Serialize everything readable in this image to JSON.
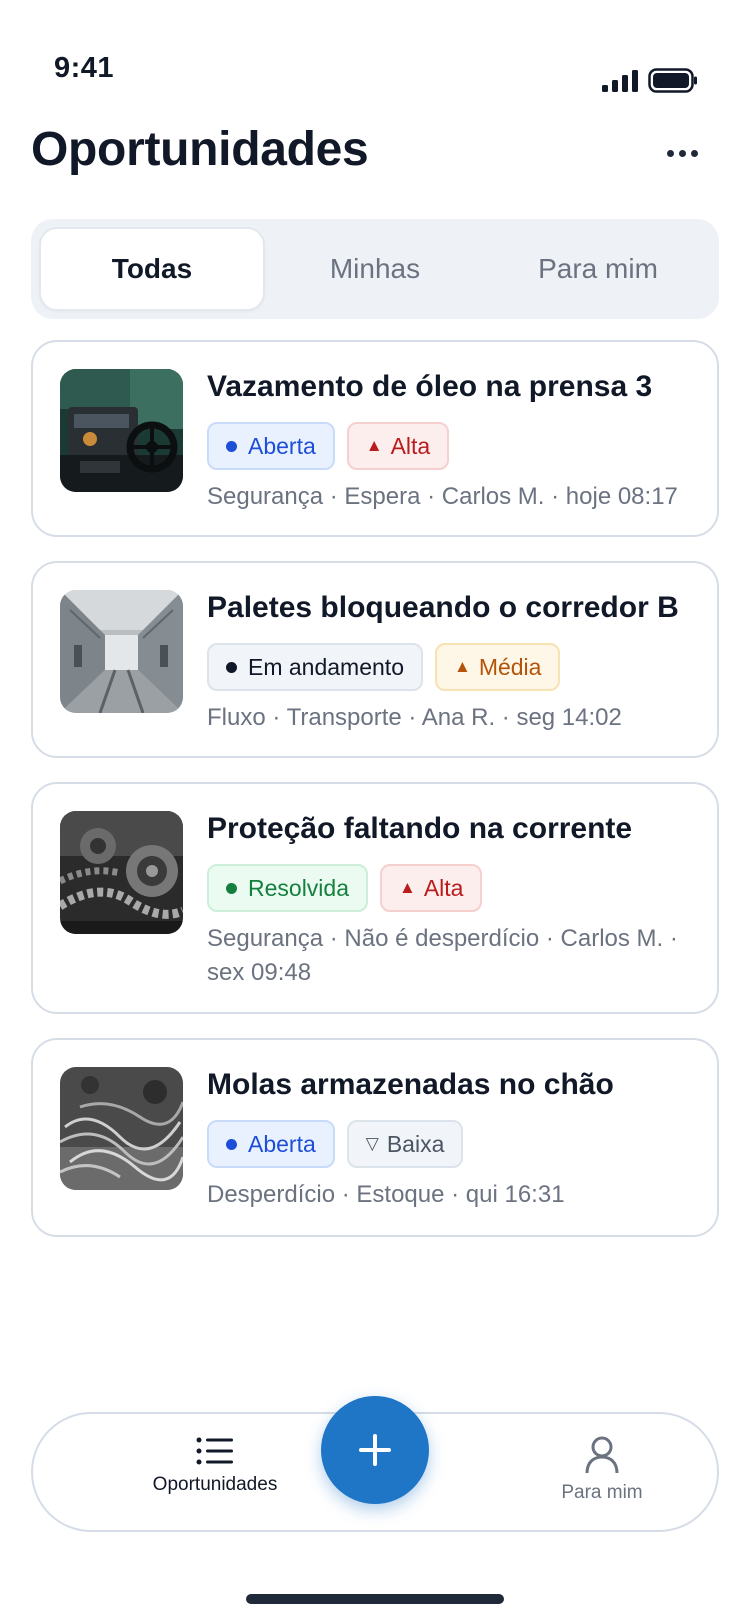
{
  "status_bar": {
    "time": "9:41"
  },
  "header": {
    "title": "Oportunidades",
    "more_icon": "more-horizontal-icon"
  },
  "tabs": [
    {
      "label": "Todas",
      "active": true
    },
    {
      "label": "Minhas",
      "active": false
    },
    {
      "label": "Para mim",
      "active": false
    }
  ],
  "opportunities": [
    {
      "title": "Vazamento de óleo na prensa 3",
      "status": "Aberta",
      "priority": "Alta",
      "meta": "Segurança · Espera · Carlos M. · hoje 08:17",
      "image": "industrial-press-photo"
    },
    {
      "title": "Paletes bloqueando o corredor B",
      "status": "Em andamento",
      "priority": "Média",
      "meta": "Fluxo · Transporte · Ana R. · seg 14:02",
      "image": "factory-aisle-photo"
    },
    {
      "title": "Proteção faltando na corrente",
      "status": "Resolvida",
      "priority": "Alta",
      "meta": "Segurança · Não é desperdício · Carlos M. · sex 09:48",
      "image": "chain-gears-photo"
    },
    {
      "title": "Molas armazenadas no chão",
      "status": "Aberta",
      "priority": "Baixa",
      "meta": "Desperdício · Estoque · qui 16:31",
      "image": "springs-floor-photo"
    }
  ],
  "bottom_nav": {
    "items": [
      {
        "label": "Oportunidades",
        "icon": "list-icon",
        "active": true
      },
      {
        "label": "Para mim",
        "icon": "person-icon",
        "active": false
      }
    ],
    "fab_icon": "plus-icon"
  },
  "colors": {
    "accent": "#1f75c6",
    "status_open": "#1d4ed8",
    "status_resolved": "#15803d",
    "priority_high": "#b91c1c",
    "priority_medium": "#b45309"
  }
}
